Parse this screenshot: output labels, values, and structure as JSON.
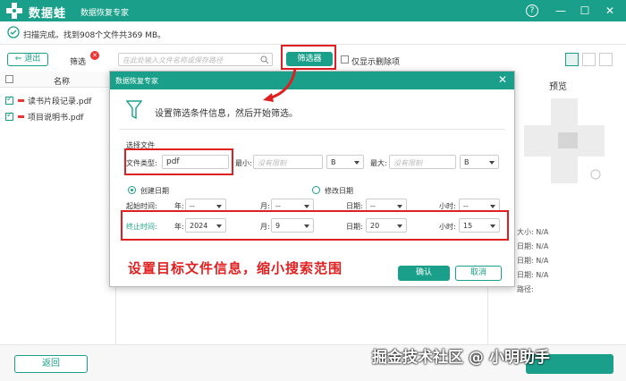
{
  "titlebar": {
    "app_name": "数据蛙",
    "subtitle": "数据恢复专家",
    "help_glyph": "?",
    "min_glyph": "—",
    "max_glyph": "☐",
    "close_glyph": "✕"
  },
  "status": {
    "text": "扫描完成。找到908个文件共369 MB。"
  },
  "toolbar": {
    "back_label": "退出",
    "filter_label": "筛选",
    "search_placeholder": "在此处输入文件名称或保存路径",
    "filter_button": "筛选器",
    "only_deleted_label": "仅显示删除项"
  },
  "list": {
    "header_name": "名称",
    "files": [
      {
        "name": "读书片段记录.pdf",
        "checked": true
      },
      {
        "name": "项目说明书.pdf",
        "checked": true
      }
    ]
  },
  "preview": {
    "title": "预览",
    "rows": [
      {
        "label": "大小:",
        "value": "N/A"
      },
      {
        "label": "日期:",
        "value": "N/A"
      },
      {
        "label": "日期:",
        "value": "N/A"
      },
      {
        "label": "日期:",
        "value": "N/A"
      },
      {
        "label": "路径:",
        "value": ""
      }
    ]
  },
  "dialog": {
    "title": "数据恢复专家",
    "heading": "设置筛选条件信息，然后开始筛选。",
    "section_label": "选择文件",
    "filetype_label": "文件类型:",
    "filetype_value": "pdf",
    "min_label": "最小:",
    "min_placeholder": "没有限制",
    "min_unit": "B",
    "max_label": "最大:",
    "max_placeholder": "没有限制",
    "max_unit": "B",
    "radio_created": "创建日期",
    "radio_modified": "修改日期",
    "start_label": "起始时间:",
    "start": {
      "year_label": "年:",
      "year": "--",
      "month_label": "月:",
      "month": "--",
      "day_label": "日期:",
      "day": "--",
      "hour_label": "小时:",
      "hour": "--"
    },
    "end_label": "终止时间:",
    "end": {
      "year_label": "年:",
      "year": "2024",
      "month_label": "月:",
      "month": "9",
      "day_label": "日期:",
      "day": "20",
      "hour_label": "小时:",
      "hour": "15"
    },
    "confirm": "确认",
    "cancel": "取消"
  },
  "annotation": "设置目标文件信息，缩小搜索范围",
  "bottom": {
    "back": "返回"
  },
  "watermark": "掘金技术社区 @ 小明助手",
  "colors": {
    "accent": "#1aa08a",
    "annotation": "#e02020"
  }
}
